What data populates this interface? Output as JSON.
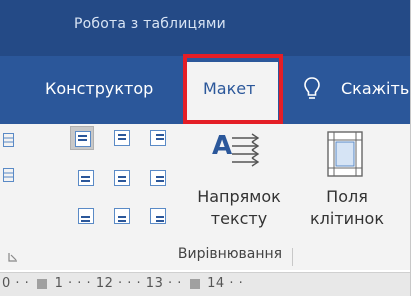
{
  "context_title": "Робота з таблицями",
  "tabs": {
    "konstruktor": "Конструктор",
    "maket": "Макет",
    "tell_me": "Скажіть"
  },
  "buttons": {
    "text_direction": {
      "line1": "Напрямок",
      "line2": "тексту"
    },
    "cell_margins": {
      "line1": "Поля",
      "line2": "клітинок"
    }
  },
  "group_label": "Вирівнювання",
  "ruler": {
    "n1": "0",
    "n2": "1",
    "n3": "12",
    "n4": "13",
    "n5": "14"
  },
  "colors": {
    "ribbon_blue": "#2b579a",
    "highlight_red": "#e41e26"
  }
}
